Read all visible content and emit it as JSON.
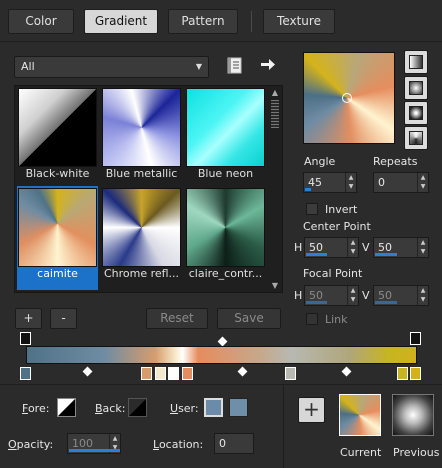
{
  "tabs": [
    {
      "label": "Color",
      "active": false
    },
    {
      "label": "Gradient",
      "active": true
    },
    {
      "label": "Pattern",
      "active": false
    },
    {
      "label": "Texture",
      "active": false
    }
  ],
  "category": {
    "selected": "All"
  },
  "gallery": {
    "items": [
      {
        "label": "Black-white",
        "selected": false
      },
      {
        "label": "Blue metallic",
        "selected": false
      },
      {
        "label": "Blue neon",
        "selected": false
      },
      {
        "label": "caimite",
        "selected": true
      },
      {
        "label": "Chrome refl...",
        "selected": false
      },
      {
        "label": "claire_contr...",
        "selected": false
      }
    ]
  },
  "buttons": {
    "add": "+",
    "remove": "-",
    "reset": "Reset",
    "save": "Save"
  },
  "angle": {
    "label": "Angle",
    "value": "45"
  },
  "repeats": {
    "label": "Repeats",
    "value": "0"
  },
  "invert": {
    "label": "Invert",
    "checked": false
  },
  "center_point": {
    "label": "Center Point",
    "h_label": "H",
    "h": "50",
    "v_label": "V",
    "v": "50"
  },
  "focal_point": {
    "label": "Focal Point",
    "h_label": "H",
    "h": "50",
    "v_label": "V",
    "v": "50",
    "enabled": false
  },
  "link": {
    "label": "Link",
    "checked": false
  },
  "fore": {
    "label": "Fore:"
  },
  "back": {
    "label": "Back:"
  },
  "user": {
    "label": "User:"
  },
  "opacity": {
    "label": "Opacity:",
    "value": "100"
  },
  "location": {
    "label": "Location:",
    "value": "0"
  },
  "swatches": {
    "current_label": "Current",
    "previous_label": "Previous",
    "add_symbol": "+"
  },
  "colors": {
    "accent": "#1b72c8",
    "user_color_1": "#6b8ba9",
    "user_color_2": "#6f8fa8",
    "gradient_stops": [
      "#4f7287",
      "#6f8ca2",
      "#d79c6c",
      "#f3e9cc",
      "#ffffff",
      "#e48c60",
      "#b7b9b2",
      "#b0a67a",
      "#c7b522",
      "#d2b11a"
    ]
  },
  "icons": {
    "library": "book-icon",
    "arrow": "right-arrow-icon"
  }
}
